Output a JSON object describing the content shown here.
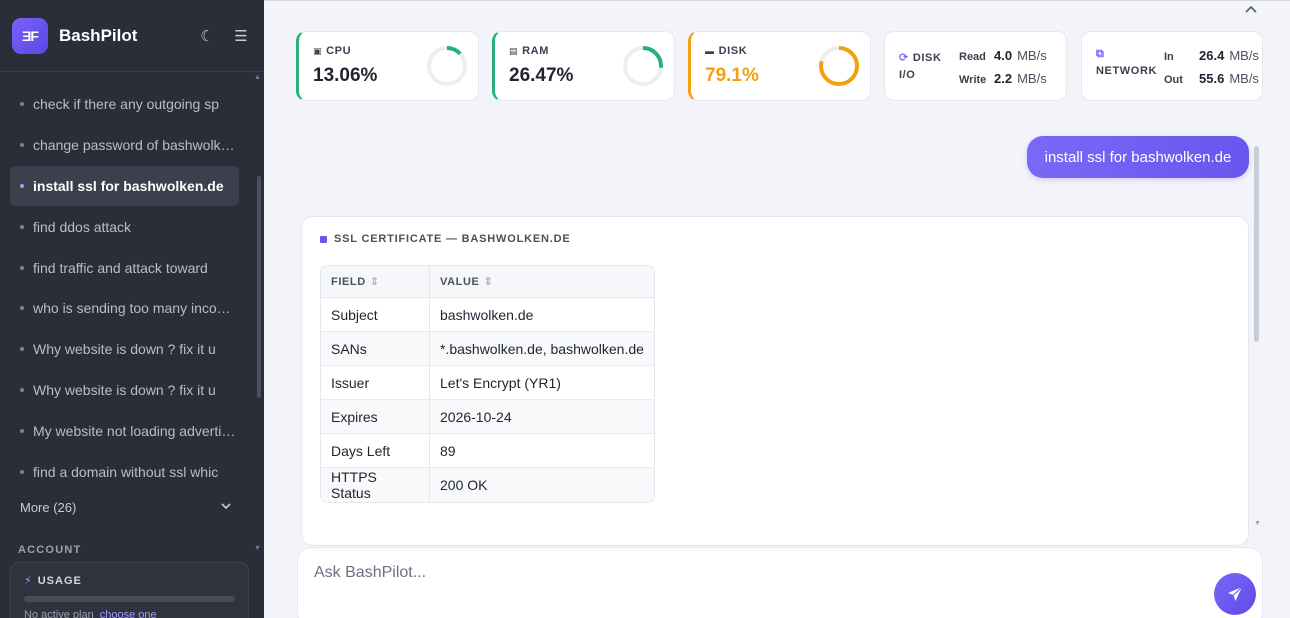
{
  "brand": {
    "logo_text": "ƎF",
    "name": "BashPilot"
  },
  "icons": {
    "theme": "moon-icon",
    "menu": "hamburger-icon",
    "send": "paper-plane-icon"
  },
  "history": [
    {
      "label": "check if there any outgoing sp",
      "active": false
    },
    {
      "label": "change password of bashwolken.de",
      "active": false
    },
    {
      "label": "install ssl for bashwolken.de",
      "active": true
    },
    {
      "label": "find ddos attack",
      "active": false
    },
    {
      "label": "find traffic and attack toward",
      "active": false
    },
    {
      "label": "who is sending too many incoming",
      "active": false
    },
    {
      "label": "Why website is down ? fix it u",
      "active": false
    },
    {
      "label": "Why website is down ? fix it u",
      "active": false
    },
    {
      "label": "My website not loading advertisements",
      "active": false
    },
    {
      "label": "find a domain without ssl whic",
      "active": false
    }
  ],
  "more_label": "More (26)",
  "account_label": "ACCOUNT",
  "usage": {
    "title": "USAGE",
    "note": "No active plan",
    "link": "choose one",
    "level_percent": 0
  },
  "stats": {
    "cpu": {
      "label": "CPU",
      "value": "13.06%",
      "percent": 13.06,
      "color": "#27b07c"
    },
    "ram": {
      "label": "RAM",
      "value": "26.47%",
      "percent": 26.47,
      "color": "#27b07c"
    },
    "disk": {
      "label": "DISK",
      "value": "79.1%",
      "percent": 79.1,
      "color": "#f2a20f"
    },
    "disk_io": {
      "label1": "DISK",
      "label2": "I/O",
      "read_label": "Read",
      "read_value": "4.0",
      "read_unit": "MB/s",
      "write_label": "Write",
      "write_value": "2.2",
      "write_unit": "MB/s"
    },
    "network": {
      "label": "NETWORK",
      "in_label": "In",
      "in_value": "26.4",
      "in_unit": "MB/s",
      "out_label": "Out",
      "out_value": "55.6",
      "out_unit": "MB/s"
    }
  },
  "user_message": "install ssl for bashwolken.de",
  "ssl_card": {
    "title": "SSL CERTIFICATE — BASHWOLKEN.DE",
    "headers": [
      "FIELD",
      "VALUE"
    ],
    "rows": [
      [
        "Subject",
        "bashwolken.de"
      ],
      [
        "SANs",
        "*.bashwolken.de, bashwolken.de"
      ],
      [
        "Issuer",
        "Let's Encrypt (YR1)"
      ],
      [
        "Expires",
        "2026-10-24"
      ],
      [
        "Days Left",
        "89"
      ],
      [
        "HTTPS Status",
        "200 OK"
      ]
    ]
  },
  "input": {
    "placeholder": "Ask BashPilot...",
    "value": ""
  }
}
